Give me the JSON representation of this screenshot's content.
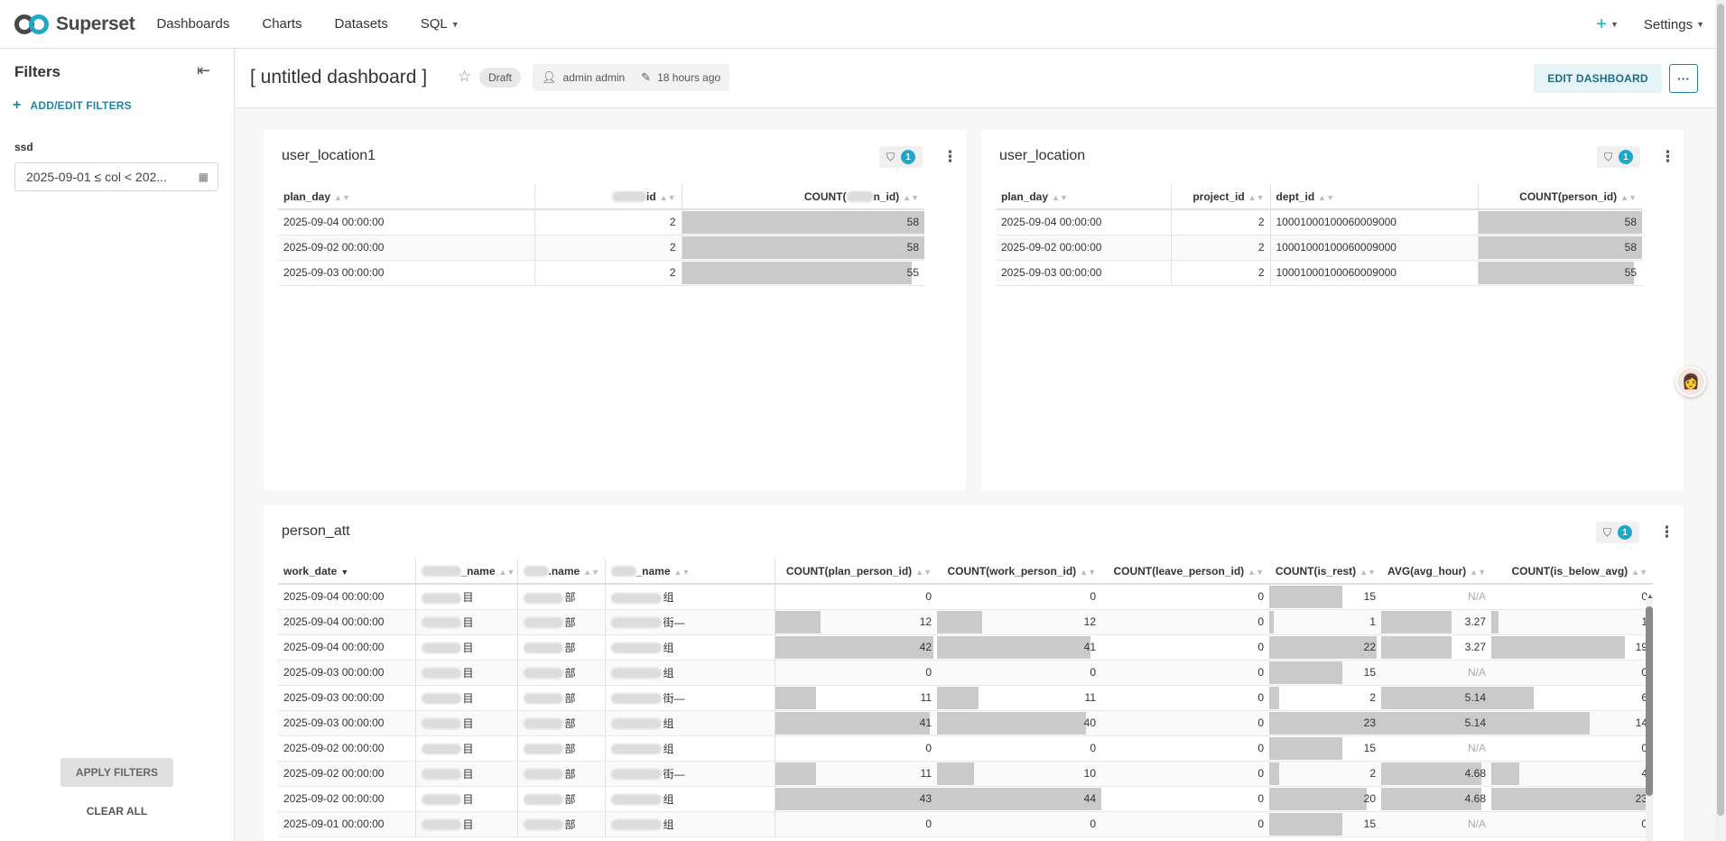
{
  "nav": {
    "logo_text": "Superset",
    "items": [
      {
        "label": "Dashboards"
      },
      {
        "label": "Charts"
      },
      {
        "label": "Datasets"
      },
      {
        "label": "SQL"
      }
    ],
    "plus_label": "+",
    "settings_label": "Settings"
  },
  "sidebar": {
    "title": "Filters",
    "add_edit_label": "ADD/EDIT FILTERS",
    "filter_label": "ssd",
    "filter_value": "2025-09-01 ≤ col < 202...",
    "apply_label": "APPLY FILTERS",
    "clear_label": "CLEAR ALL"
  },
  "header": {
    "title": "[ untitled dashboard ]",
    "status": "Draft",
    "owner": "admin admin",
    "modified": "18 hours ago",
    "edit_label": "EDIT DASHBOARD",
    "more_label": "···"
  },
  "charts": {
    "user_location1": {
      "title": "user_location1",
      "filter_count": "1",
      "columns": [
        "plan_day",
        "id",
        "COUNT(",
        "n_id)"
      ],
      "rows": [
        {
          "plan_day": "2025-09-04 00:00:00",
          "id": "2",
          "count": "58",
          "fraction": 1.0
        },
        {
          "plan_day": "2025-09-02 00:00:00",
          "id": "2",
          "count": "58",
          "fraction": 1.0
        },
        {
          "plan_day": "2025-09-03 00:00:00",
          "id": "2",
          "count": "55",
          "fraction": 0.948
        }
      ]
    },
    "user_location": {
      "title": "user_location",
      "filter_count": "1",
      "columns": [
        "plan_day",
        "project_id",
        "dept_id",
        "COUNT(person_id)"
      ],
      "rows": [
        {
          "plan_day": "2025-09-04 00:00:00",
          "project_id": "2",
          "dept_id": "10001000100060009000",
          "count": "58",
          "fraction": 1.0
        },
        {
          "plan_day": "2025-09-02 00:00:00",
          "project_id": "2",
          "dept_id": "10001000100060009000",
          "count": "58",
          "fraction": 1.0
        },
        {
          "plan_day": "2025-09-03 00:00:00",
          "project_id": "2",
          "dept_id": "10001000100060009000",
          "count": "55",
          "fraction": 0.948
        }
      ]
    },
    "person_att": {
      "title": "person_att",
      "filter_count": "1",
      "columns": [
        "work_date",
        "_name",
        ".name",
        "_name",
        "COUNT(plan_person_id)",
        "COUNT(work_person_id)",
        "COUNT(leave_person_id)",
        "COUNT(is_rest)",
        "AVG(avg_hour)",
        "COUNT(is_below_avg)"
      ],
      "rows": [
        {
          "work_date": "2025-09-04 00:00:00",
          "a": "目",
          "b": "部",
          "c": "组",
          "plan": "0",
          "work": "0",
          "leave": "0",
          "rest": "15",
          "avg": "N/A",
          "below": "0"
        },
        {
          "work_date": "2025-09-04 00:00:00",
          "a": "目",
          "b": "部",
          "c": "街—",
          "plan": "12",
          "work": "12",
          "leave": "0",
          "rest": "1",
          "avg": "3.27",
          "below": "1"
        },
        {
          "work_date": "2025-09-04 00:00:00",
          "a": "目",
          "b": "部",
          "c": "组",
          "plan": "42",
          "work": "41",
          "leave": "0",
          "rest": "22",
          "avg": "3.27",
          "below": "19"
        },
        {
          "work_date": "2025-09-03 00:00:00",
          "a": "目",
          "b": "部",
          "c": "组",
          "plan": "0",
          "work": "0",
          "leave": "0",
          "rest": "15",
          "avg": "N/A",
          "below": "0"
        },
        {
          "work_date": "2025-09-03 00:00:00",
          "a": "目",
          "b": "部",
          "c": "街—",
          "plan": "11",
          "work": "11",
          "leave": "0",
          "rest": "2",
          "avg": "5.14",
          "below": "6"
        },
        {
          "work_date": "2025-09-03 00:00:00",
          "a": "目",
          "b": "部",
          "c": "组",
          "plan": "41",
          "work": "40",
          "leave": "0",
          "rest": "23",
          "avg": "5.14",
          "below": "14"
        },
        {
          "work_date": "2025-09-02 00:00:00",
          "a": "目",
          "b": "部",
          "c": "组",
          "plan": "0",
          "work": "0",
          "leave": "0",
          "rest": "15",
          "avg": "N/A",
          "below": "0"
        },
        {
          "work_date": "2025-09-02 00:00:00",
          "a": "目",
          "b": "部",
          "c": "街—",
          "plan": "11",
          "work": "10",
          "leave": "0",
          "rest": "2",
          "avg": "4.68",
          "below": "4"
        },
        {
          "work_date": "2025-09-02 00:00:00",
          "a": "目",
          "b": "部",
          "c": "组",
          "plan": "43",
          "work": "44",
          "leave": "0",
          "rest": "20",
          "avg": "4.68",
          "below": "23"
        },
        {
          "work_date": "2025-09-01 00:00:00",
          "a": "目",
          "b": "部",
          "c": "组",
          "plan": "0",
          "work": "0",
          "leave": "0",
          "rest": "15",
          "avg": "N/A",
          "below": "0"
        }
      ]
    }
  },
  "colors": {
    "accent": "#20a7c9",
    "bar": "#cacaca",
    "link": "#1f85a6"
  },
  "icons": {
    "collapse": "collapse-left-icon",
    "calendar": "calendar-icon",
    "star": "star-icon",
    "user": "user-icon",
    "edit": "pencil-icon",
    "filter": "filter-icon",
    "menu": "vertical-dots-icon"
  }
}
